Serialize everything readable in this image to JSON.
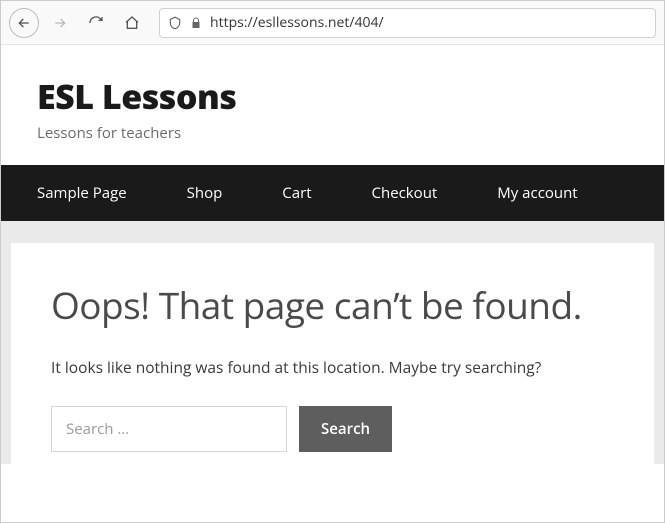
{
  "browser": {
    "url": "https://esllessons.net/404/"
  },
  "site": {
    "title": "ESL Lessons",
    "tagline": "Lessons for teachers"
  },
  "nav": {
    "items": [
      {
        "label": "Sample Page"
      },
      {
        "label": "Shop"
      },
      {
        "label": "Cart"
      },
      {
        "label": "Checkout"
      },
      {
        "label": "My account"
      }
    ]
  },
  "error": {
    "heading": "Oops! That page can’t be found.",
    "message": "It looks like nothing was found at this location. Maybe try searching?"
  },
  "search": {
    "placeholder": "Search …",
    "button": "Search"
  }
}
